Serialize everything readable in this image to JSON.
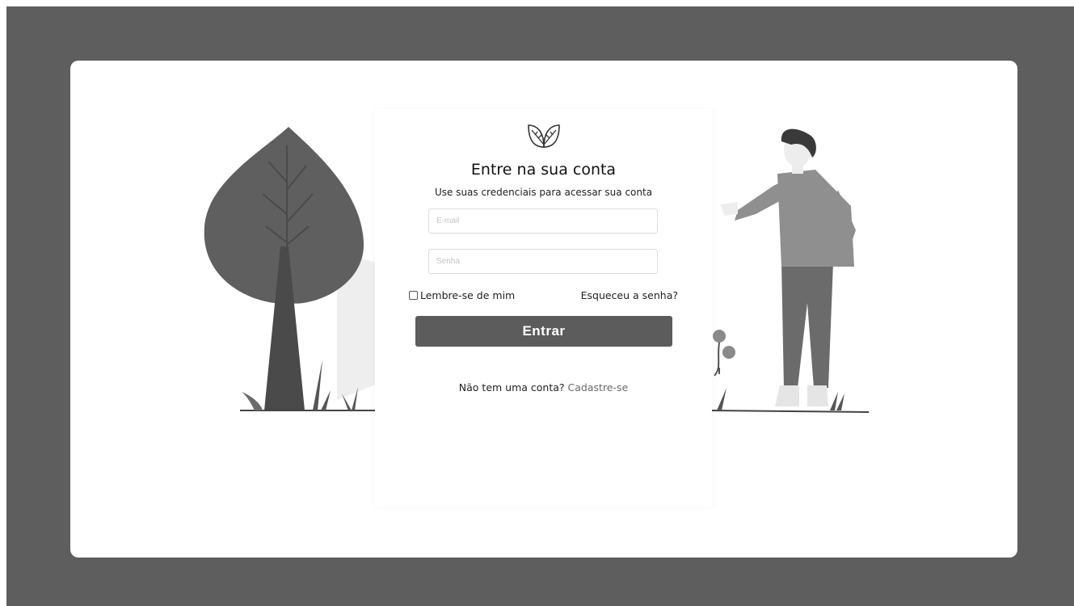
{
  "login": {
    "title": "Entre na sua conta",
    "subtitle": "Use suas credenciais para acessar sua conta",
    "email_placeholder": "E-mail",
    "password_placeholder": "Senha",
    "remember_label": "Lembre-se de mim",
    "forgot_label": "Esqueceu a senha?",
    "submit_label": "Entrar",
    "signup_prompt": "Não tem uma conta?",
    "signup_link": "Cadastre-se"
  },
  "icons": {
    "logo": "leaves-icon",
    "checkbox": "checkbox-unchecked"
  },
  "colors": {
    "background": "#5e5e5e",
    "card": "#ffffff",
    "button": "#5c5c5c",
    "tree": "#5f5f5f",
    "shirt": "#8f8f8f",
    "pants": "#6b6b6b"
  }
}
